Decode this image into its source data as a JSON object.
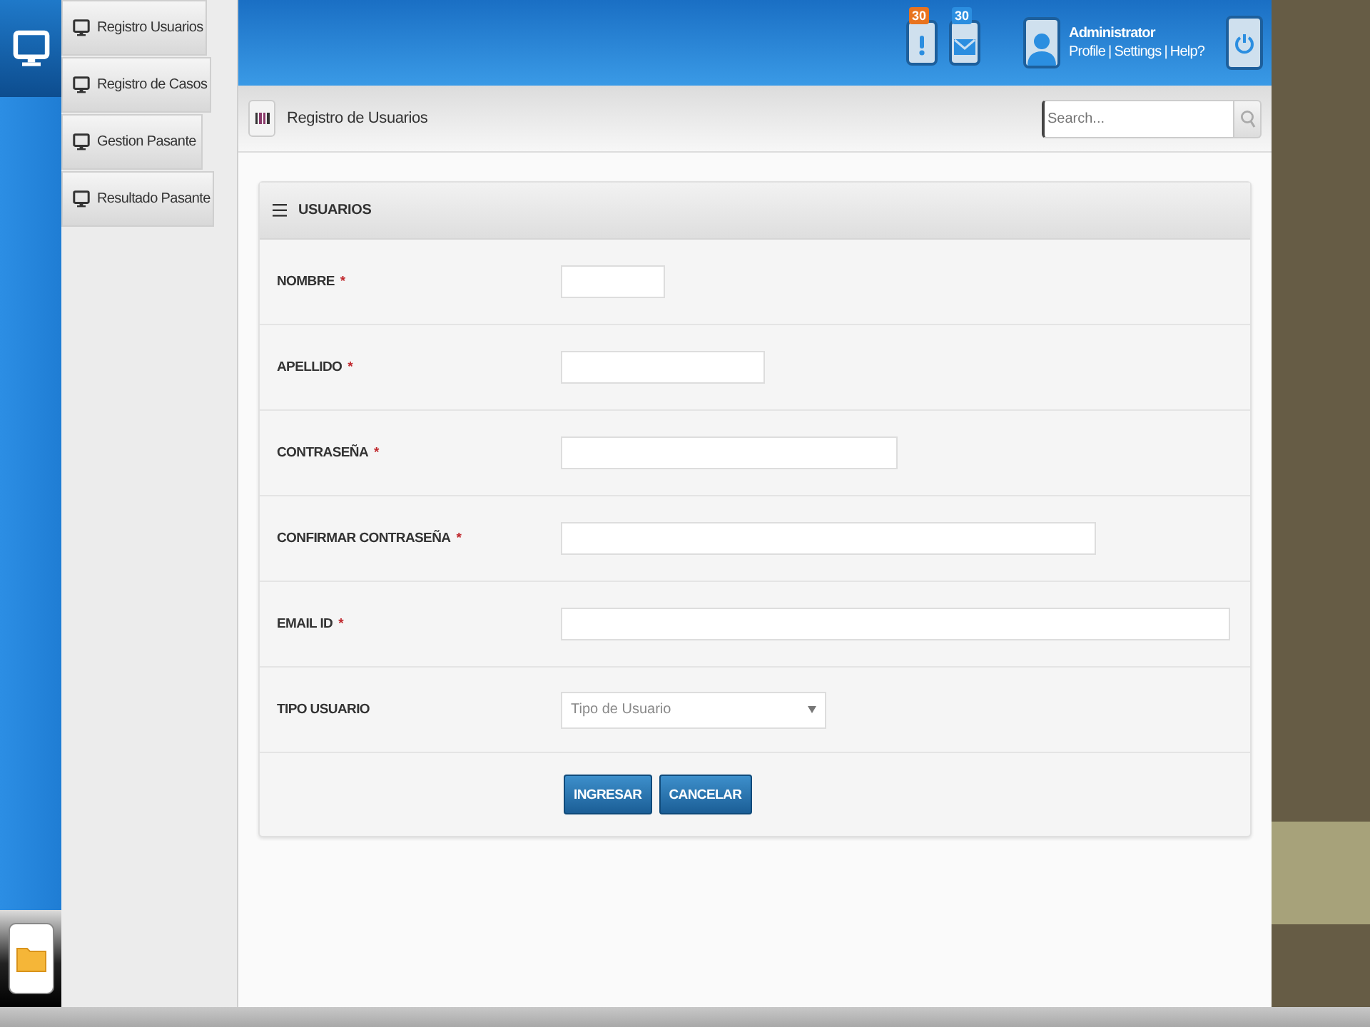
{
  "nav": {
    "items": [
      {
        "label": "Registro Usuarios",
        "selected": false
      },
      {
        "label": "Registro de Casos",
        "selected": false
      },
      {
        "label": "Gestion Pasante",
        "selected": false
      },
      {
        "label": "Resultado Pasante",
        "selected": false
      }
    ]
  },
  "top_bar": {
    "notifications": [
      {
        "kind": "alert",
        "count": "30"
      },
      {
        "kind": "mail",
        "count": "30"
      }
    ],
    "user": {
      "name": "Administrator",
      "links": [
        "Profile",
        "Settings",
        "Help?"
      ],
      "separator": "|"
    }
  },
  "page_header": {
    "title": "Registro de Usuarios",
    "search": {
      "placeholder": "Search..."
    }
  },
  "form": {
    "title": "USUARIOS",
    "fields": [
      {
        "kind": "text",
        "label": "NOMBRE",
        "required_mark": "*"
      },
      {
        "kind": "text",
        "label": "APELLIDO",
        "required_mark": "*"
      },
      {
        "kind": "text",
        "label": "CONTRASEÑA",
        "required_mark": "*"
      },
      {
        "kind": "text",
        "label": "CONFIRMAR CONTRASEÑA",
        "required_mark": "*"
      },
      {
        "kind": "text",
        "label": "EMAIL ID",
        "required_mark": "*"
      },
      {
        "kind": "select",
        "label": "TIPO USUARIO",
        "placeholder": "Tipo de Usuario"
      }
    ],
    "buttons": [
      "INGRESAR",
      "CANCELAR"
    ]
  }
}
